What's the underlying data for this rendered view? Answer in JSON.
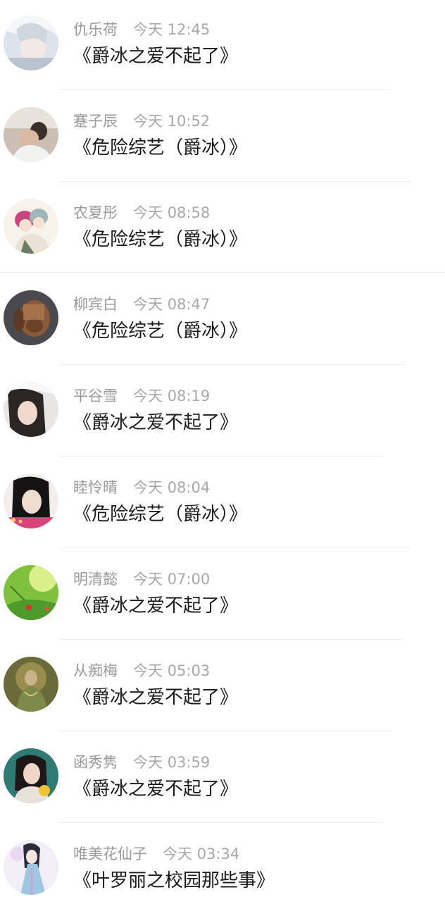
{
  "feed": {
    "items": [
      {
        "name": "仇乐荷",
        "date_label": "今天",
        "time": "12:45",
        "title": "《爵冰之爱不起了》"
      },
      {
        "name": "蹇子辰",
        "date_label": "今天",
        "time": "10:52",
        "title": "《危险综艺（爵冰）》"
      },
      {
        "name": "农夏彤",
        "date_label": "今天",
        "time": "08:58",
        "title": "《危险综艺（爵冰）》"
      },
      {
        "name": "柳宾白",
        "date_label": "今天",
        "time": "08:47",
        "title": "《危险综艺（爵冰）》"
      },
      {
        "name": "平谷雪",
        "date_label": "今天",
        "time": "08:19",
        "title": "《爵冰之爱不起了》"
      },
      {
        "name": "睦怜晴",
        "date_label": "今天",
        "time": "08:04",
        "title": "《危险综艺（爵冰）》"
      },
      {
        "name": "明清懿",
        "date_label": "今天",
        "time": "07:00",
        "title": "《爵冰之爱不起了》"
      },
      {
        "name": "从痴梅",
        "date_label": "今天",
        "time": "05:03",
        "title": "《爵冰之爱不起了》"
      },
      {
        "name": "函秀隽",
        "date_label": "今天",
        "time": "03:59",
        "title": "《爵冰之爱不起了》"
      },
      {
        "name": "唯美花仙子",
        "date_label": "今天",
        "time": "03:34",
        "title": "《叶罗丽之校园那些事》"
      }
    ]
  }
}
